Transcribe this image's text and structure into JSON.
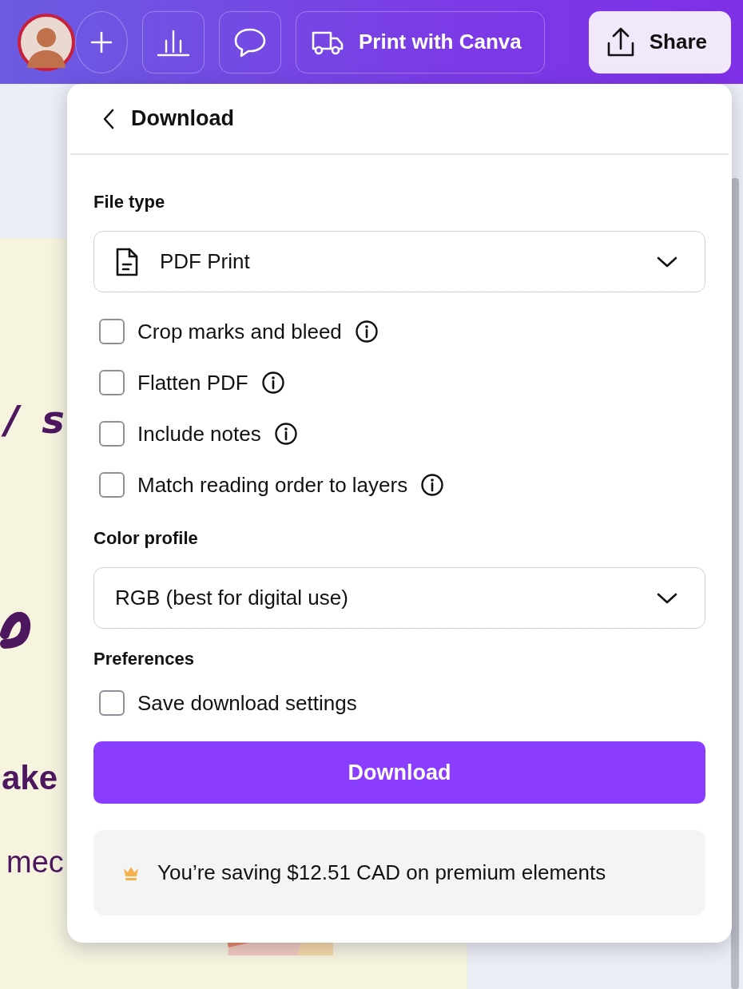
{
  "toolbar": {
    "print_button": "Print with Canva",
    "share_button": "Share"
  },
  "design_page": {
    "texts": [
      {
        "kind": "script",
        "text": "/ s"
      },
      {
        "kind": "heading",
        "text": "ake"
      },
      {
        "kind": "body",
        "text": "mec"
      }
    ]
  },
  "download_panel": {
    "title": "Download",
    "file_type": {
      "label": "File type",
      "value": "PDF Print"
    },
    "options": [
      {
        "label": "Crop marks and bleed",
        "checked": false,
        "info": true
      },
      {
        "label": "Flatten PDF",
        "checked": false,
        "info": true
      },
      {
        "label": "Include notes",
        "checked": false,
        "info": true
      },
      {
        "label": "Match reading order to layers",
        "checked": false,
        "info": true
      }
    ],
    "color_profile": {
      "label": "Color profile",
      "value": "RGB (best for digital use)"
    },
    "preferences": {
      "label": "Preferences",
      "options": [
        {
          "label": "Save download settings",
          "checked": false,
          "info": false
        }
      ]
    },
    "download_button": "Download",
    "savings_note": "You’re saving $12.51 CAD on premium elements"
  }
}
